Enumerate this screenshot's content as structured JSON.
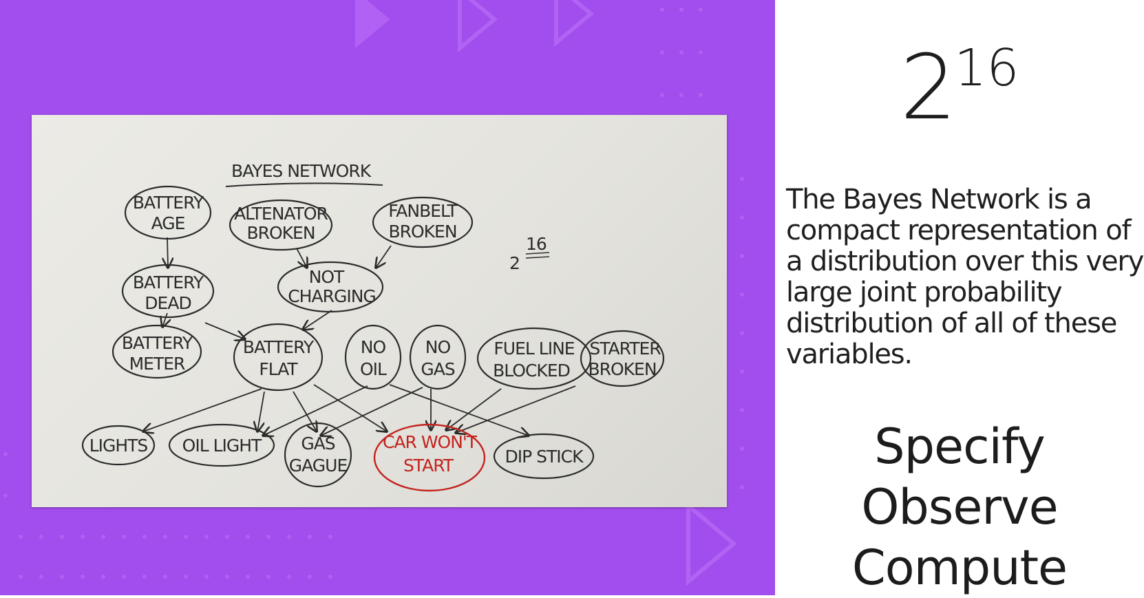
{
  "colors": {
    "background": "#a24ded",
    "decoration": "#b569f5",
    "ink": "#2b2b2b",
    "red_ink": "#c4221e"
  },
  "whiteboard": {
    "title": "BAYES NETWORK",
    "annotation_base": "2",
    "annotation_exp": "16",
    "nodes": {
      "battery_age": [
        "BATTERY",
        "AGE"
      ],
      "alternator_broken": [
        "ALTENATOR",
        "BROKEN"
      ],
      "fanbelt_broken": [
        "FANBELT",
        "BROKEN"
      ],
      "battery_dead": [
        "BATTERY",
        "DEAD"
      ],
      "not_charging": [
        "NOT",
        "CHARGING"
      ],
      "battery_meter": [
        "BATTERY",
        "METER"
      ],
      "battery_flat": [
        "BATTERY",
        "FLAT"
      ],
      "no_oil": [
        "NO",
        "OIL"
      ],
      "no_gas": [
        "NO",
        "GAS"
      ],
      "fuel_line_blocked": [
        "FUEL LINE",
        "BLOCKED"
      ],
      "starter_broken": [
        "STARTER",
        "BROKEN"
      ],
      "lights": [
        "LIGHTS"
      ],
      "oil_light": [
        "OIL LIGHT"
      ],
      "gas_gauge": [
        "GAS",
        "GAGUE"
      ],
      "car_wont_start": [
        "CAR WON'T",
        "START"
      ],
      "dip_stick": [
        "DIP STICK"
      ]
    }
  },
  "sidebar": {
    "big_number_base": "2",
    "big_number_exp": "16",
    "description": "The Bayes Network is a compact representation of a distribution over this very large joint probability distribution of all of these variables.",
    "steps": [
      "Specify",
      "Observe",
      "Compute"
    ]
  }
}
